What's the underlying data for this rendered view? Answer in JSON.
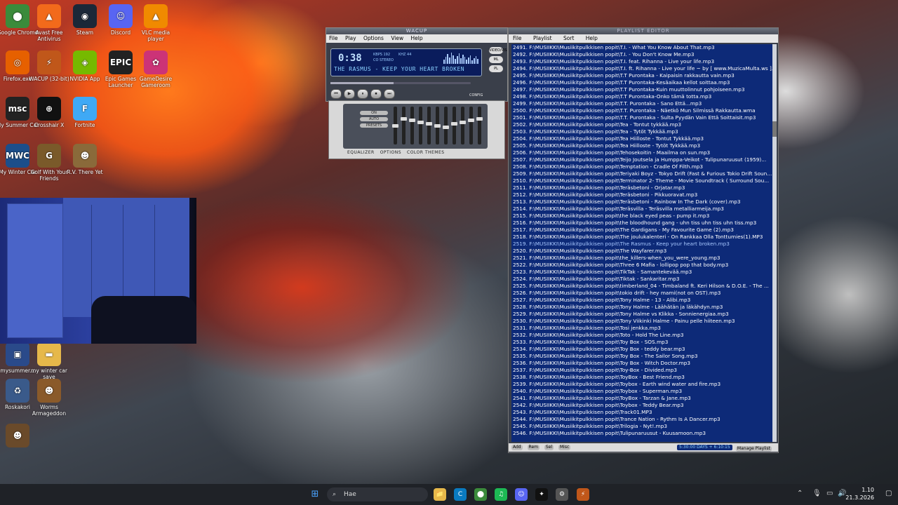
{
  "desktop": {
    "icons": [
      {
        "label": "Google Chrome",
        "color": "#3b8b3b",
        "glyph": "⬤"
      },
      {
        "label": "Avast Free Antivirus",
        "color": "#f26a1b",
        "glyph": "▲"
      },
      {
        "label": "Steam",
        "color": "#1b2838",
        "glyph": "◉"
      },
      {
        "label": "Discord",
        "color": "#5865f2",
        "glyph": "☺"
      },
      {
        "label": "VLC media player",
        "color": "#f08a00",
        "glyph": "▲"
      },
      {
        "label": "Firefox.exe",
        "color": "#e66000",
        "glyph": "◎"
      },
      {
        "label": "WACUP (32-bit)",
        "color": "#c0571a",
        "glyph": "⚡"
      },
      {
        "label": "NVIDIA App",
        "color": "#76b900",
        "glyph": "◈"
      },
      {
        "label": "Epic Games Launcher",
        "color": "#222222",
        "glyph": "EPIC"
      },
      {
        "label": "GameDesire Gameroom",
        "color": "#cc3377",
        "glyph": "✿"
      },
      {
        "label": "My Summer Car",
        "color": "#222222",
        "glyph": "msc"
      },
      {
        "label": "Crosshair X",
        "color": "#111111",
        "glyph": "⊕"
      },
      {
        "label": "Fortnite",
        "color": "#3fa9f5",
        "glyph": "F"
      },
      {
        "label": "My Winter Car",
        "color": "#1c4e8a",
        "glyph": "MWC"
      },
      {
        "label": "Golf With Your Friends",
        "color": "#7a5a2a",
        "glyph": "G"
      },
      {
        "label": "R.V. There Yet",
        "color": "#8a6a3a",
        "glyph": "☻"
      },
      {
        "label": "mysummer...",
        "color": "#2a4a8a",
        "glyph": "▣"
      },
      {
        "label": "my winter car save",
        "color": "#e6b84a",
        "glyph": "▬"
      },
      {
        "label": "Roskakori",
        "color": "#3a5a8a",
        "glyph": "♻"
      },
      {
        "label": "Worms Armageddon",
        "color": "#8a5a2a",
        "glyph": "☻"
      },
      {
        "label": "",
        "color": "#6a4a2a",
        "glyph": "☻"
      }
    ]
  },
  "wacup": {
    "title": "WACUP",
    "menu": [
      "File",
      "Play",
      "Options",
      "View",
      "Help"
    ],
    "time": "0:38",
    "kbps_label": "KBPS 192",
    "khz_label": "KHZ 44",
    "stereo_label": "CO STEREO",
    "track_scroll": "THE RASMUS - KEEP YOUR HEART BROKEN",
    "seek_position_pct": 45,
    "controls": [
      "⏮",
      "▶",
      "⏸",
      "⏹",
      "⏭"
    ],
    "side_buttons": [
      "VIDEO/VIS",
      "ML",
      "PL"
    ],
    "config_label": "CONFIG",
    "eq_tabs": [
      "EQUALIZER",
      "OPTIONS",
      "COLOR THEMES"
    ],
    "eq_side_buttons": [
      "ON",
      "AUTO",
      "PRESETS"
    ],
    "eq_band_levels": [
      0.5,
      0.3,
      0.35,
      0.4,
      0.45,
      0.5,
      0.55,
      0.45,
      0.4,
      0.35,
      0.3
    ]
  },
  "playlist": {
    "title": "PLAYLIST EDITOR",
    "menu": [
      "File",
      "Playlist",
      "Sort",
      "Help"
    ],
    "current_index": 28,
    "rows": [
      "2491. F:\\MUSIIKKI\\Musiikitpulkkisen popit\\T.I. - What You Know About That.mp3",
      "2492. F:\\MUSIIKKI\\Musiikitpulkkisen popit\\T.I. - You Don't Know Me.mp3",
      "2493. F:\\MUSIIKKI\\Musiikitpulkkisen popit\\T.I. feat. Rihanna - Live your life.mp3",
      "2494. F:\\MUSIIKKI\\Musiikitpulkkisen popit\\T.I. ft. Rihanna - Live your life ~ by [ www.MuzicaMulta.ws ]...",
      "2495. F:\\MUSIIKKI\\Musiikitpulkkisen popit\\T.T Purontaka - Kaipaisin rakkautta vain.mp3",
      "2496. F:\\MUSIIKKI\\Musiikitpulkkisen popit\\T.T Purontaka-Kesäaikaa kellot soittaa.mp3",
      "2497. F:\\MUSIIKKI\\Musiikitpulkkisen popit\\T.T Purontaka-Kuin muuttolinnut pohjoiseen.mp3",
      "2498. F:\\MUSIIKKI\\Musiikitpulkkisen popit\\T.T Purontaka-Onko tämä totta.mp3",
      "2499. F:\\MUSIIKKI\\Musiikitpulkkisen popit\\T.T. Purontaka - Sano Että...mp3",
      "2500. F:\\MUSIIKKI\\Musiikitpulkkisen popit\\T.T. Purontaka - Näetkö Mun Silmissä Rakkautta.wma",
      "2501. F:\\MUSIIKKI\\Musiikitpulkkisen popit\\T.T. Purontaka - Sulta Pyydän Vain Että Soittaisit.mp3",
      "2502. F:\\MUSIIKKI\\Musiikitpulkkisen popit\\Tea - Tontut tykkää.mp3",
      "2503. F:\\MUSIIKKI\\Musiikitpulkkisen popit\\Tea - Tytöt Tykkää.mp3",
      "2504. F:\\MUSIIKKI\\Musiikitpulkkisen popit\\Tea Hiilloste - Tontut Tykkää.mp3",
      "2505. F:\\MUSIIKKI\\Musiikitpulkkisen popit\\Tea Hiilloste - Tytöt Tykkää.mp3",
      "2506. F:\\MUSIIKKI\\Musiikitpulkkisen popit\\Tehosekoitin - Maailma on sun.mp3",
      "2507. F:\\MUSIIKKI\\Musiikitpulkkisen popit\\Teijo Joutsela ja Humppa-Veikot - Tulipunaruusut (1959)...",
      "2508. F:\\MUSIIKKI\\Musiikitpulkkisen popit\\Temptation - Cradle Of Filth.mp3",
      "2509. F:\\MUSIIKKI\\Musiikitpulkkisen popit\\Teriyaki Boyz - Tokyo Drift (Fast & Furious Tokio Drift Soun...",
      "2510. F:\\MUSIIKKI\\Musiikitpulkkisen popit\\Terminator 2- Theme - Movie Soundtrack ( Surround Sou...",
      "2511. F:\\MUSIIKKI\\Musiikitpulkkisen popit\\Teräsbetoni - Orjatar.mp3",
      "2512. F:\\MUSIIKKI\\Musiikitpulkkisen popit\\Teräsbetoni - Pikkuoravat.mp3",
      "2513. F:\\MUSIIKKI\\Musiikitpulkkisen popit\\Teräsbetoni - Rainbow In The Dark (cover).mp3",
      "2514. F:\\MUSIIKKI\\Musiikitpulkkisen popit\\Teräsvilla - Teräsvilla metalliarmeija.mp3",
      "2515. F:\\MUSIIKKI\\Musiikitpulkkisen popit\\the black eyed peas - pump it.mp3",
      "2516. F:\\MUSIIKKI\\Musiikitpulkkisen popit\\the bloodhound gang - uhn tiss uhn tiss uhn tiss.mp3",
      "2517. F:\\MUSIIKKI\\Musiikitpulkkisen popit\\The Gardigans - My Favourite Game (2).mp3",
      "2518. F:\\MUSIIKKI\\Musiikitpulkkisen popit\\The joulukalenteri - On Rankkaa Olla Tonttumies(1).MP3",
      "2519. F:\\MUSIIKKI\\Musiikitpulkkisen popit\\The Rasmus - Keep your heart broken.mp3",
      "2520. F:\\MUSIIKKI\\Musiikitpulkkisen popit\\The Wayfarer.mp3",
      "2521. F:\\MUSIIKKI\\Musiikitpulkkisen popit\\the_killers-when_you_were_young.mp3",
      "2522. F:\\MUSIIKKI\\Musiikitpulkkisen popit\\Three 6 Mafia - lollipop pop that body.mp3",
      "2523. F:\\MUSIIKKI\\Musiikitpulkkisen popit\\TikTak - Samantekevää.mp3",
      "2524. F:\\MUSIIKKI\\Musiikitpulkkisen popit\\Tiktak - Sankaritar.mp3",
      "2525. F:\\MUSIIKKI\\Musiikitpulkkisen popit\\timberland_04 - Timbaland ft. Keri Hilson & D.O.E. - The ...",
      "2526. F:\\MUSIIKKI\\Musiikitpulkkisen popit\\tokio drift - hey mami(not on OST).mp3",
      "2527. F:\\MUSIIKKI\\Musiikitpulkkisen popit\\Tony Halme - 13 - Alibi.mp3",
      "2528. F:\\MUSIIKKI\\Musiikitpulkkisen popit\\Tony Halme - Läähätän ja läkähdyn.mp3",
      "2529. F:\\MUSIIKKI\\Musiikitpulkkisen popit\\Tony Halme vs Klikka - Sonnienergiaa.mp3",
      "2530. F:\\MUSIIKKI\\Musiikitpulkkisen popit\\Tony Viikinki Halme - Painu pelle hiiteen.mp3",
      "2531. F:\\MUSIIKKI\\Musiikitpulkkisen popit\\Tosi jenkka.mp3",
      "2532. F:\\MUSIIKKI\\Musiikitpulkkisen popit\\Toto - Hold The Line.mp3",
      "2533. F:\\MUSIIKKI\\Musiikitpulkkisen popit\\Toy Box - SOS.mp3",
      "2534. F:\\MUSIIKKI\\Musiikitpulkkisen popit\\Toy Box - teddy bear.mp3",
      "2535. F:\\MUSIIKKI\\Musiikitpulkkisen popit\\Toy Box - The Sailor Song.mp3",
      "2536. F:\\MUSIIKKI\\Musiikitpulkkisen popit\\Toy Box - Witch Doctor.mp3",
      "2537. F:\\MUSIIKKI\\Musiikitpulkkisen popit\\Toy-Box - Divided.mp3",
      "2538. F:\\MUSIIKKI\\Musiikitpulkkisen popit\\ToyBox - Best Friend.mp3",
      "2539. F:\\MUSIIKKI\\Musiikitpulkkisen popit\\Toybox - Earth wind water and fire.mp3",
      "2540. F:\\MUSIIKKI\\Musiikitpulkkisen popit\\Toybox - Superman.mp3",
      "2541. F:\\MUSIIKKI\\Musiikitpulkkisen popit\\ToyBox - Tarzan & Jane.mp3",
      "2542. F:\\MUSIIKKI\\Musiikitpulkkisen popit\\Toybox - Teddy Bear.mp3",
      "2543. F:\\MUSIIKKI\\Musiikitpulkkisen popit\\Track01.MP3",
      "2544. F:\\MUSIIKKI\\Musiikitpulkkisen popit\\Trance Nation - Rythm Is A Dancer.mp3",
      "2545. F:\\MUSIIKKI\\Musiikitpulkkisen popit\\Trilogia - Nyt!.mp3",
      "2546. F:\\MUSIIKKI\\Musiikitpulkkisen popit\\Tulipunaruusut - Kuusamoon.mp3"
    ],
    "bottom_buttons": [
      "Add",
      "Rem",
      "Sel",
      "Misc"
    ],
    "time_display": "5:30:00 DAYS + 6:10:15",
    "manage_label": "Manage Playlist"
  },
  "taskbar": {
    "search_placeholder": "Hae",
    "apps": [
      "⊞",
      "📁",
      "C",
      "⬤",
      "♫",
      "☺",
      "✦",
      "⚙",
      "⚡"
    ],
    "time": "1.10",
    "date": "21.3.2026"
  },
  "colors": {
    "accent": "#0d2a78",
    "playlist_text": "#ffffff",
    "current_track": "#a8c8ff"
  }
}
